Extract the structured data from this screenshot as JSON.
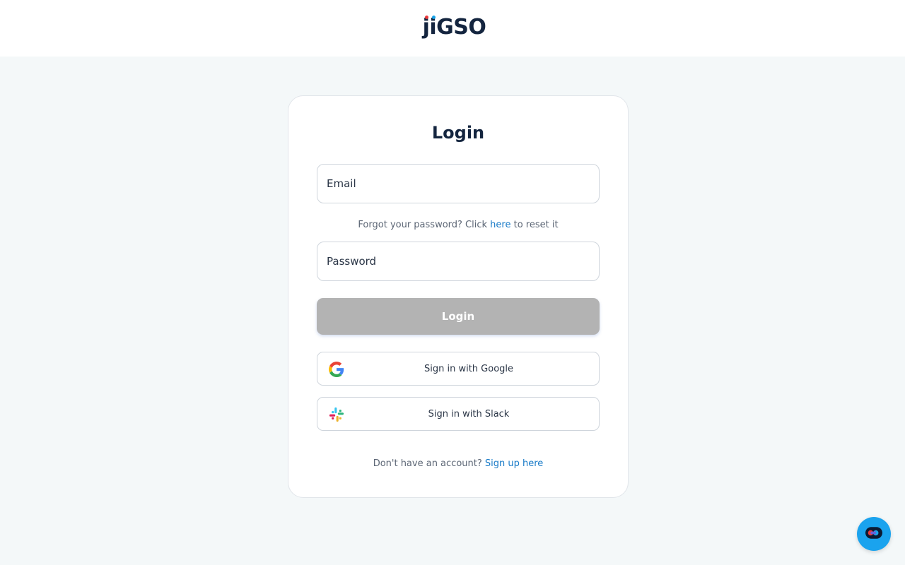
{
  "header": {
    "logo_text": "jiGSO"
  },
  "login_card": {
    "title": "Login",
    "email": {
      "placeholder": "Email",
      "value": ""
    },
    "forgot": {
      "prefix": "Forgot your password? Click ",
      "link": "here",
      "suffix": " to reset it"
    },
    "password": {
      "placeholder": "Password",
      "value": ""
    },
    "login_button": "Login",
    "google_button": "Sign in with Google",
    "slack_button": "Sign in with Slack",
    "signup": {
      "prefix": "Don't have an account? ",
      "link": "Sign up here"
    }
  },
  "colors": {
    "brand_navy": "#14253f",
    "link_blue": "#1679c7",
    "disabled_button": "#b3b3b3",
    "chat_blue": "#1aa3ee"
  },
  "icons": {
    "google": "google-icon",
    "slack": "slack-icon",
    "chat": "chat-widget-icon"
  }
}
